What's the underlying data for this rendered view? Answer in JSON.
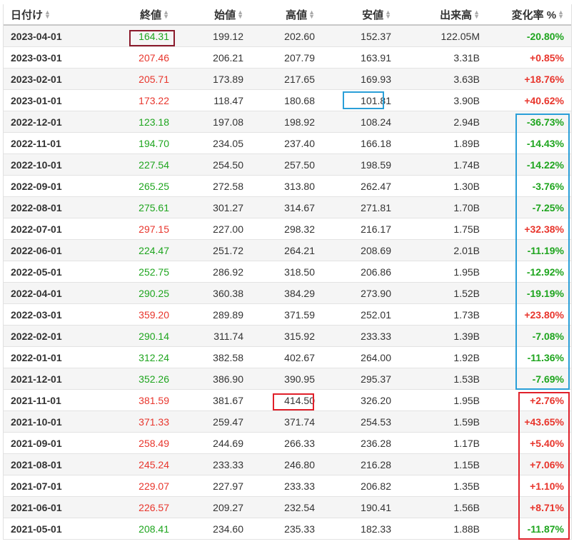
{
  "columns": [
    "日付け",
    "終値",
    "始値",
    "高値",
    "安値",
    "出来高",
    "変化率 %"
  ],
  "sort_icon": "sort-arrows-icon",
  "colors": {
    "up": "#e8352c",
    "down": "#1ea51e",
    "box_dark_red": "#8b1a2b",
    "box_blue": "#2a9fd8",
    "box_red": "#e0202a"
  },
  "rows": [
    {
      "date": "2023-04-01",
      "close": "164.31",
      "open": "199.12",
      "high": "202.60",
      "low": "152.37",
      "volume": "122.05M",
      "change": "-20.80%",
      "dir": "down"
    },
    {
      "date": "2023-03-01",
      "close": "207.46",
      "open": "206.21",
      "high": "207.79",
      "low": "163.91",
      "volume": "3.31B",
      "change": "+0.85%",
      "dir": "up"
    },
    {
      "date": "2023-02-01",
      "close": "205.71",
      "open": "173.89",
      "high": "217.65",
      "low": "169.93",
      "volume": "3.63B",
      "change": "+18.76%",
      "dir": "up"
    },
    {
      "date": "2023-01-01",
      "close": "173.22",
      "open": "118.47",
      "high": "180.68",
      "low": "101.81",
      "volume": "3.90B",
      "change": "+40.62%",
      "dir": "up"
    },
    {
      "date": "2022-12-01",
      "close": "123.18",
      "open": "197.08",
      "high": "198.92",
      "low": "108.24",
      "volume": "2.94B",
      "change": "-36.73%",
      "dir": "down"
    },
    {
      "date": "2022-11-01",
      "close": "194.70",
      "open": "234.05",
      "high": "237.40",
      "low": "166.18",
      "volume": "1.89B",
      "change": "-14.43%",
      "dir": "down"
    },
    {
      "date": "2022-10-01",
      "close": "227.54",
      "open": "254.50",
      "high": "257.50",
      "low": "198.59",
      "volume": "1.74B",
      "change": "-14.22%",
      "dir": "down"
    },
    {
      "date": "2022-09-01",
      "close": "265.25",
      "open": "272.58",
      "high": "313.80",
      "low": "262.47",
      "volume": "1.30B",
      "change": "-3.76%",
      "dir": "down"
    },
    {
      "date": "2022-08-01",
      "close": "275.61",
      "open": "301.27",
      "high": "314.67",
      "low": "271.81",
      "volume": "1.70B",
      "change": "-7.25%",
      "dir": "down"
    },
    {
      "date": "2022-07-01",
      "close": "297.15",
      "open": "227.00",
      "high": "298.32",
      "low": "216.17",
      "volume": "1.75B",
      "change": "+32.38%",
      "dir": "up"
    },
    {
      "date": "2022-06-01",
      "close": "224.47",
      "open": "251.72",
      "high": "264.21",
      "low": "208.69",
      "volume": "2.01B",
      "change": "-11.19%",
      "dir": "down"
    },
    {
      "date": "2022-05-01",
      "close": "252.75",
      "open": "286.92",
      "high": "318.50",
      "low": "206.86",
      "volume": "1.95B",
      "change": "-12.92%",
      "dir": "down"
    },
    {
      "date": "2022-04-01",
      "close": "290.25",
      "open": "360.38",
      "high": "384.29",
      "low": "273.90",
      "volume": "1.52B",
      "change": "-19.19%",
      "dir": "down"
    },
    {
      "date": "2022-03-01",
      "close": "359.20",
      "open": "289.89",
      "high": "371.59",
      "low": "252.01",
      "volume": "1.73B",
      "change": "+23.80%",
      "dir": "up"
    },
    {
      "date": "2022-02-01",
      "close": "290.14",
      "open": "311.74",
      "high": "315.92",
      "low": "233.33",
      "volume": "1.39B",
      "change": "-7.08%",
      "dir": "down"
    },
    {
      "date": "2022-01-01",
      "close": "312.24",
      "open": "382.58",
      "high": "402.67",
      "low": "264.00",
      "volume": "1.92B",
      "change": "-11.36%",
      "dir": "down"
    },
    {
      "date": "2021-12-01",
      "close": "352.26",
      "open": "386.90",
      "high": "390.95",
      "low": "295.37",
      "volume": "1.53B",
      "change": "-7.69%",
      "dir": "down"
    },
    {
      "date": "2021-11-01",
      "close": "381.59",
      "open": "381.67",
      "high": "414.50",
      "low": "326.20",
      "volume": "1.95B",
      "change": "+2.76%",
      "dir": "up"
    },
    {
      "date": "2021-10-01",
      "close": "371.33",
      "open": "259.47",
      "high": "371.74",
      "low": "254.53",
      "volume": "1.59B",
      "change": "+43.65%",
      "dir": "up"
    },
    {
      "date": "2021-09-01",
      "close": "258.49",
      "open": "244.69",
      "high": "266.33",
      "low": "236.28",
      "volume": "1.17B",
      "change": "+5.40%",
      "dir": "up"
    },
    {
      "date": "2021-08-01",
      "close": "245.24",
      "open": "233.33",
      "high": "246.80",
      "low": "216.28",
      "volume": "1.15B",
      "change": "+7.06%",
      "dir": "up"
    },
    {
      "date": "2021-07-01",
      "close": "229.07",
      "open": "227.97",
      "high": "233.33",
      "low": "206.82",
      "volume": "1.35B",
      "change": "+1.10%",
      "dir": "up"
    },
    {
      "date": "2021-06-01",
      "close": "226.57",
      "open": "209.27",
      "high": "232.54",
      "low": "190.41",
      "volume": "1.56B",
      "change": "+8.71%",
      "dir": "up"
    },
    {
      "date": "2021-05-01",
      "close": "208.41",
      "open": "234.60",
      "high": "235.33",
      "low": "182.33",
      "volume": "1.88B",
      "change": "-11.87%",
      "dir": "down"
    }
  ]
}
